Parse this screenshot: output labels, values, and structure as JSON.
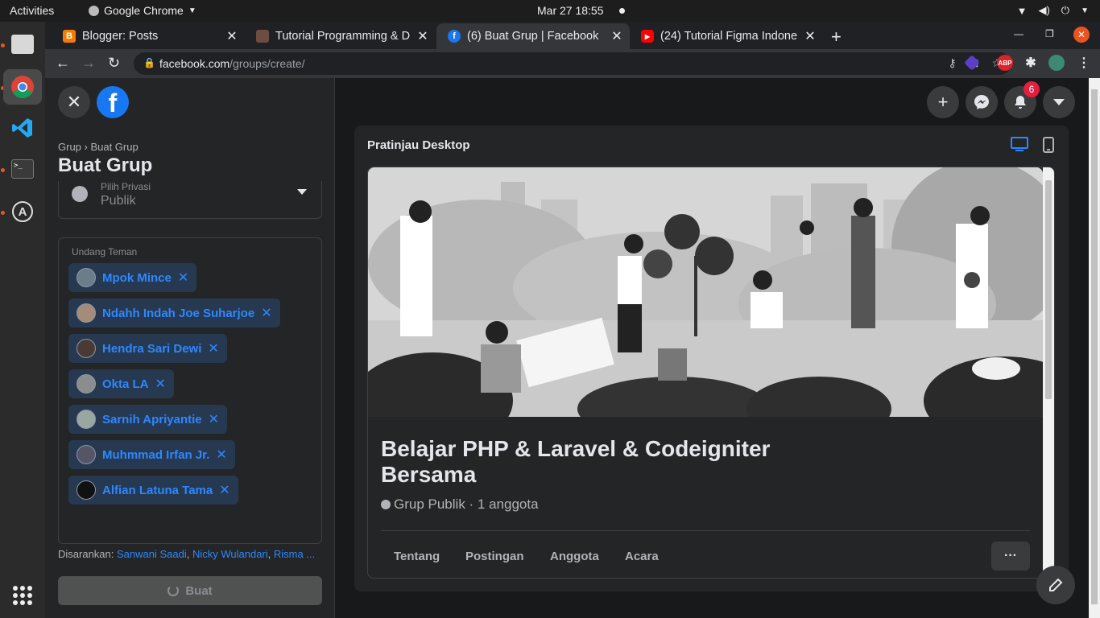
{
  "os": {
    "activities": "Activities",
    "app_name": "Google Chrome",
    "clock": "Mar 27  18:55"
  },
  "browser": {
    "tabs": [
      {
        "title": "Blogger: Posts",
        "favicon": "blogger-icon",
        "color": "#f57c00"
      },
      {
        "title": "Tutorial Programming & D",
        "favicon": "avatar-icon",
        "color": "#6d4c41"
      },
      {
        "title": "(6) Buat Grup | Facebook",
        "favicon": "facebook-icon",
        "color": "#1877f2"
      },
      {
        "title": "(24) Tutorial Figma Indone",
        "favicon": "youtube-icon",
        "color": "#ff0000"
      }
    ],
    "url_host": "facebook.com",
    "url_path": "/groups/create/",
    "ext_abp": "ABP"
  },
  "sidebar": {
    "breadcrumb": "Grup › Buat Grup",
    "title": "Buat Grup",
    "privacy": {
      "label": "Pilih Privasi",
      "value": "Publik"
    },
    "invite_label": "Undang Teman",
    "invitees": [
      {
        "name": "Mpok Mince"
      },
      {
        "name": "Ndahh Indah Joe Suharjoe"
      },
      {
        "name": "Hendra Sari Dewi"
      },
      {
        "name": "Okta LA"
      },
      {
        "name": "Sarnih Apriyantie"
      },
      {
        "name": "Muhmmad Irfan Jr."
      },
      {
        "name": "Alfian Latuna Tama"
      }
    ],
    "suggest_prefix": "Disarankan:",
    "suggestions": [
      "Sanwani Saadi",
      "Nicky Wulandari",
      "Risma ..."
    ],
    "create_label": "Buat"
  },
  "header": {
    "notif_count": "6"
  },
  "preview": {
    "title": "Pratinjau Desktop",
    "group_name": "Belajar PHP & Laravel & Codeigniter Bersama",
    "group_meta": "Grup Publik · 1 anggota",
    "tabs": [
      "Tentang",
      "Postingan",
      "Anggota",
      "Acara"
    ],
    "more_label": "···"
  },
  "colors": {
    "fb_blue": "#1877f2",
    "link": "#2d88ff",
    "panel": "#242526",
    "bg": "#18191a"
  }
}
